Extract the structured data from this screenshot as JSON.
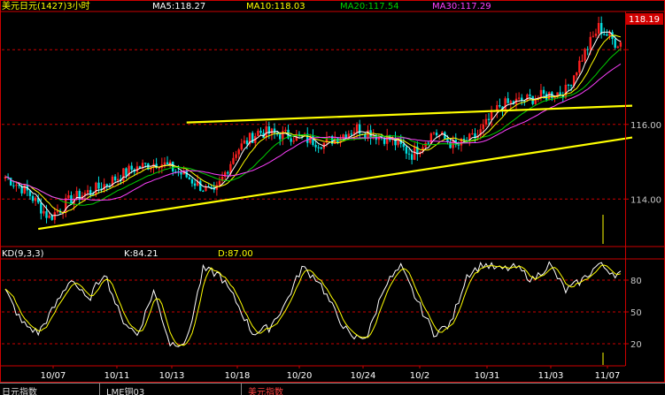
{
  "chart_data": [
    {
      "type": "candlestick",
      "title": "美元日元(1427)3小时",
      "legend": [
        {
          "label": "MA5:118.27",
          "color": "#ffffff"
        },
        {
          "label": "MA10:118.03",
          "color": "#ffff00"
        },
        {
          "label": "MA20:117.54",
          "color": "#00d000"
        },
        {
          "label": "MA30:117.29",
          "color": "#ff40ff"
        }
      ],
      "y_ticks": [
        "116.00",
        "114.00"
      ],
      "last_price_label": "118.19",
      "ylim": [
        112.8,
        119.0
      ],
      "x_ticks": [
        "10/07",
        "10/11",
        "10/13",
        "10/18",
        "10/20",
        "10/24",
        "10/2",
        "10/31",
        "11/03",
        "11/07"
      ],
      "colors": {
        "up": "#ff2020",
        "down": "#00e0e0",
        "trendline": "#ffff00",
        "ma5": "#ffffff",
        "ma10": "#ffff00",
        "ma20": "#00d000",
        "ma30": "#ff40ff",
        "grid": "#cc0000",
        "axis": "#cc0000"
      },
      "trendlines": [
        {
          "from": {
            "x": "10/07",
            "y": 113.2
          },
          "to": {
            "x": "11/07+",
            "y": 115.65
          }
        },
        {
          "from": {
            "x": "10/18",
            "y": 116.05
          },
          "to": {
            "x": "11/07+",
            "y": 116.5
          }
        }
      ],
      "close_path": [
        {
          "i": 0,
          "y": 114.6
        },
        {
          "i": 8,
          "y": 114.2
        },
        {
          "i": 16,
          "y": 113.5
        },
        {
          "i": 24,
          "y": 114.0
        },
        {
          "i": 34,
          "y": 114.3
        },
        {
          "i": 46,
          "y": 114.8
        },
        {
          "i": 56,
          "y": 115.0
        },
        {
          "i": 66,
          "y": 114.6
        },
        {
          "i": 76,
          "y": 114.1
        },
        {
          "i": 84,
          "y": 115.3
        },
        {
          "i": 92,
          "y": 115.8
        },
        {
          "i": 104,
          "y": 115.7
        },
        {
          "i": 116,
          "y": 115.5
        },
        {
          "i": 128,
          "y": 115.9
        },
        {
          "i": 140,
          "y": 115.6
        },
        {
          "i": 148,
          "y": 115.2
        },
        {
          "i": 156,
          "y": 115.8
        },
        {
          "i": 164,
          "y": 115.4
        },
        {
          "i": 172,
          "y": 115.7
        },
        {
          "i": 180,
          "y": 116.5
        },
        {
          "i": 192,
          "y": 116.7
        },
        {
          "i": 204,
          "y": 116.9
        },
        {
          "i": 210,
          "y": 117.8
        },
        {
          "i": 216,
          "y": 118.6
        },
        {
          "i": 222,
          "y": 118.2
        }
      ]
    },
    {
      "type": "line",
      "title": "KD(9,3,3)",
      "values_label": [
        {
          "label": "K:84.21",
          "color": "#ffffff"
        },
        {
          "label": "D:87.00",
          "color": "#ffff00"
        }
      ],
      "y_ticks": [
        "80",
        "50",
        "20"
      ],
      "ylim": [
        0,
        100
      ],
      "series": [
        {
          "key": "K",
          "color": "#ffffff"
        },
        {
          "key": "D",
          "color": "#ffff00"
        }
      ],
      "k_path": [
        {
          "i": 0,
          "y": 70
        },
        {
          "i": 6,
          "y": 40
        },
        {
          "i": 12,
          "y": 30
        },
        {
          "i": 18,
          "y": 55
        },
        {
          "i": 24,
          "y": 82
        },
        {
          "i": 30,
          "y": 60
        },
        {
          "i": 36,
          "y": 88
        },
        {
          "i": 42,
          "y": 45
        },
        {
          "i": 48,
          "y": 28
        },
        {
          "i": 54,
          "y": 70
        },
        {
          "i": 60,
          "y": 20
        },
        {
          "i": 66,
          "y": 22
        },
        {
          "i": 72,
          "y": 90
        },
        {
          "i": 78,
          "y": 85
        },
        {
          "i": 84,
          "y": 60
        },
        {
          "i": 90,
          "y": 30
        },
        {
          "i": 96,
          "y": 35
        },
        {
          "i": 102,
          "y": 58
        },
        {
          "i": 108,
          "y": 92
        },
        {
          "i": 114,
          "y": 80
        },
        {
          "i": 120,
          "y": 50
        },
        {
          "i": 126,
          "y": 25
        },
        {
          "i": 132,
          "y": 28
        },
        {
          "i": 138,
          "y": 75
        },
        {
          "i": 144,
          "y": 92
        },
        {
          "i": 150,
          "y": 60
        },
        {
          "i": 156,
          "y": 30
        },
        {
          "i": 162,
          "y": 38
        },
        {
          "i": 168,
          "y": 85
        },
        {
          "i": 174,
          "y": 95
        },
        {
          "i": 180,
          "y": 90
        },
        {
          "i": 186,
          "y": 92
        },
        {
          "i": 192,
          "y": 80
        },
        {
          "i": 198,
          "y": 95
        },
        {
          "i": 204,
          "y": 70
        },
        {
          "i": 210,
          "y": 80
        },
        {
          "i": 216,
          "y": 95
        },
        {
          "i": 222,
          "y": 86
        }
      ]
    }
  ],
  "bottom_tabs": [
    {
      "label": "日元指数"
    },
    {
      "label": "LME铜03"
    },
    {
      "label": "美元指数"
    }
  ]
}
